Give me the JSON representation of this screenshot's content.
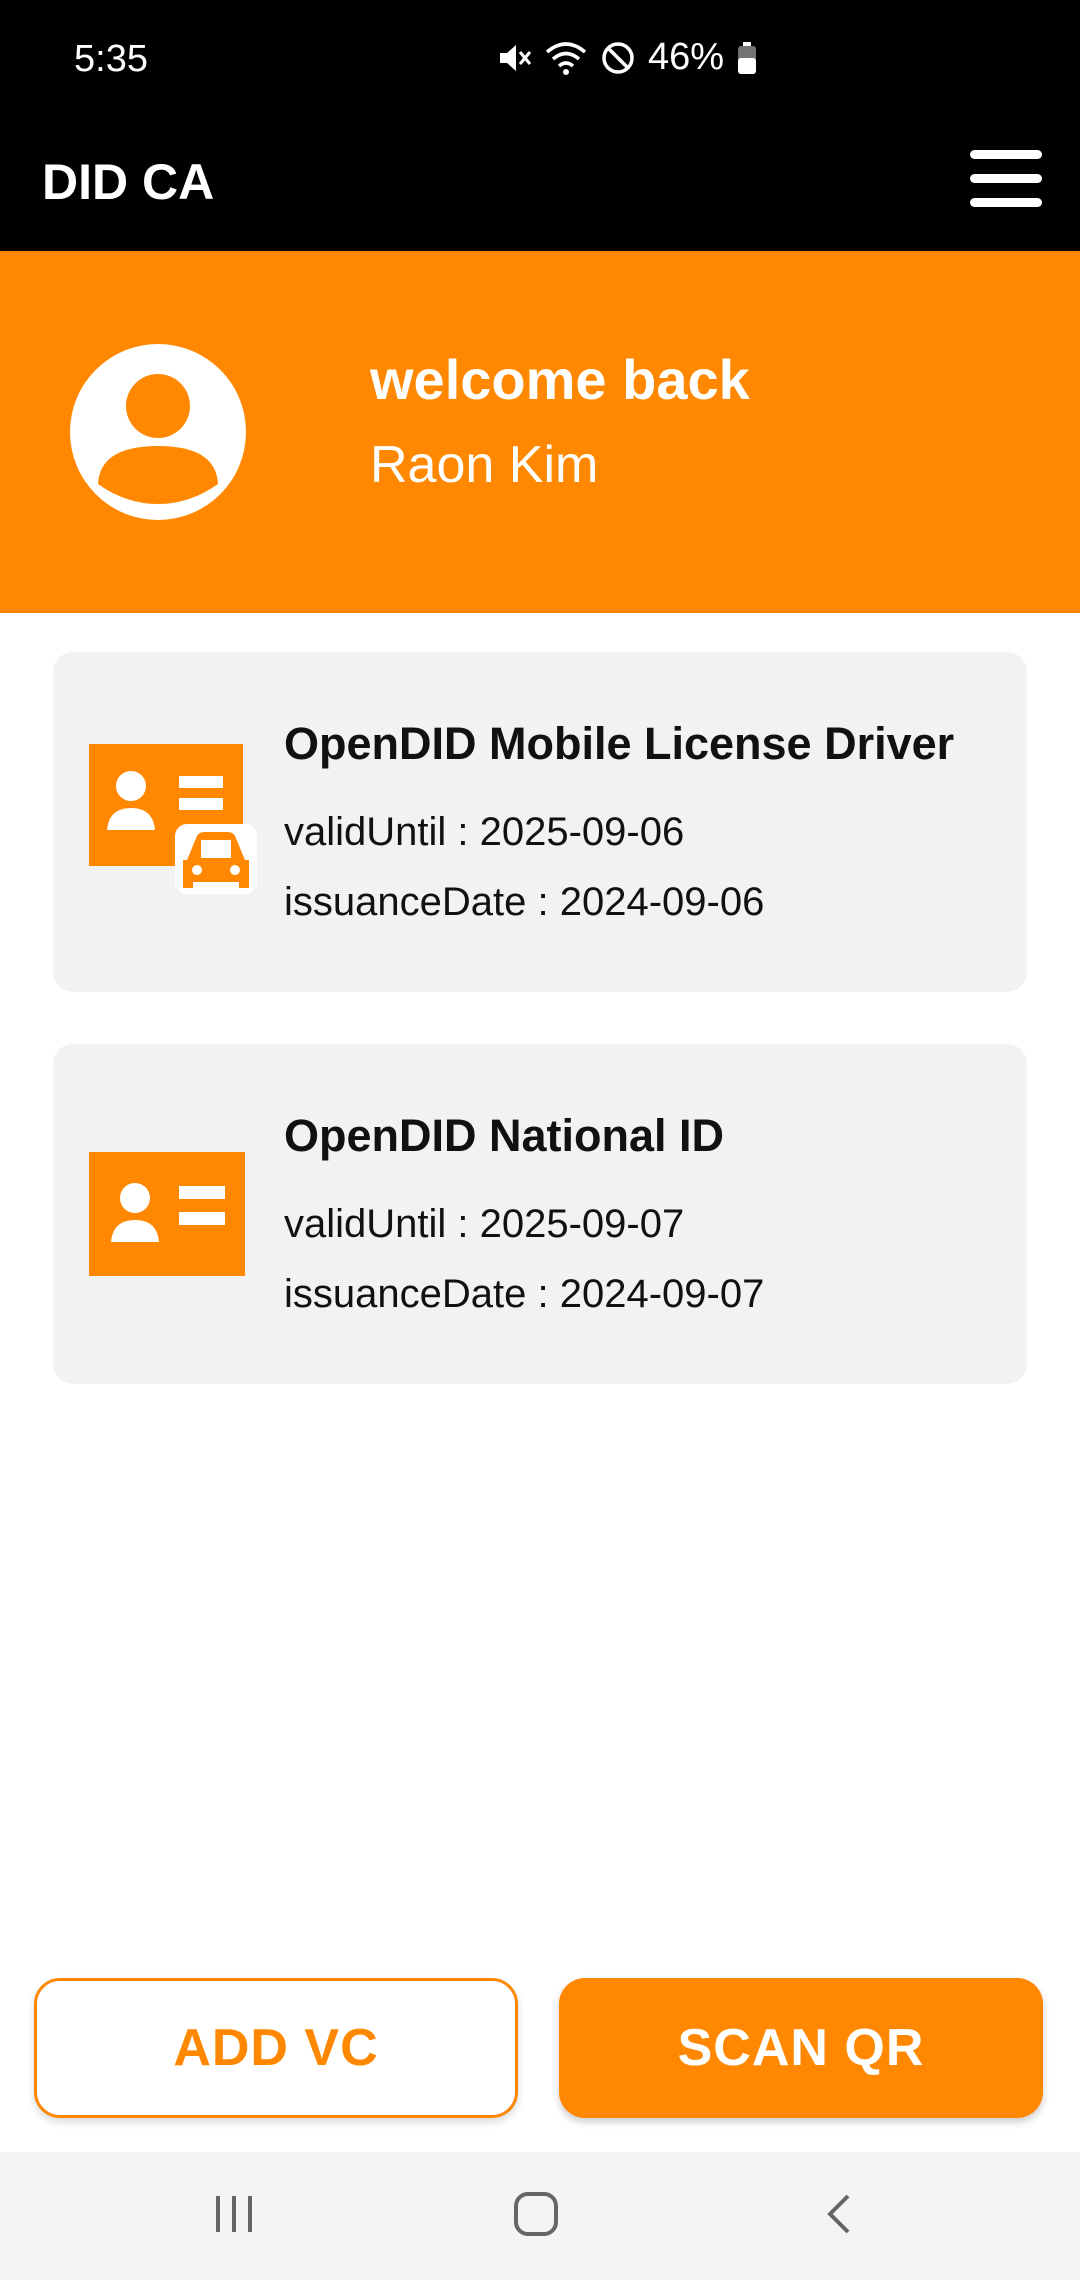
{
  "status_bar": {
    "time": "5:35",
    "battery_percent": "46%",
    "icons": [
      "mute-icon",
      "wifi-icon",
      "do-not-disturb-icon",
      "battery-icon"
    ]
  },
  "app_bar": {
    "title": "DID CA",
    "menu_icon": "hamburger-menu-icon"
  },
  "hero": {
    "greeting": "welcome back",
    "user_name": "Raon Kim",
    "avatar_icon": "user-avatar-icon"
  },
  "credentials": [
    {
      "title": "OpenDID Mobile License Driver",
      "valid_until": "validUntil : 2025-09-06",
      "issuance_date": "issuanceDate : 2024-09-06",
      "icon": "driver-license-icon"
    },
    {
      "title": "OpenDID National ID",
      "valid_until": "validUntil : 2025-09-07",
      "issuance_date": "issuanceDate : 2024-09-07",
      "icon": "id-card-icon"
    }
  ],
  "actions": {
    "add_vc": "ADD VC",
    "scan_qr": "SCAN QR"
  },
  "nav": {
    "items": [
      "recent-apps-icon",
      "home-icon",
      "back-icon"
    ]
  },
  "colors": {
    "accent": "#ff8800",
    "card_bg": "#f2f2f4",
    "bar_bg": "#000000"
  }
}
